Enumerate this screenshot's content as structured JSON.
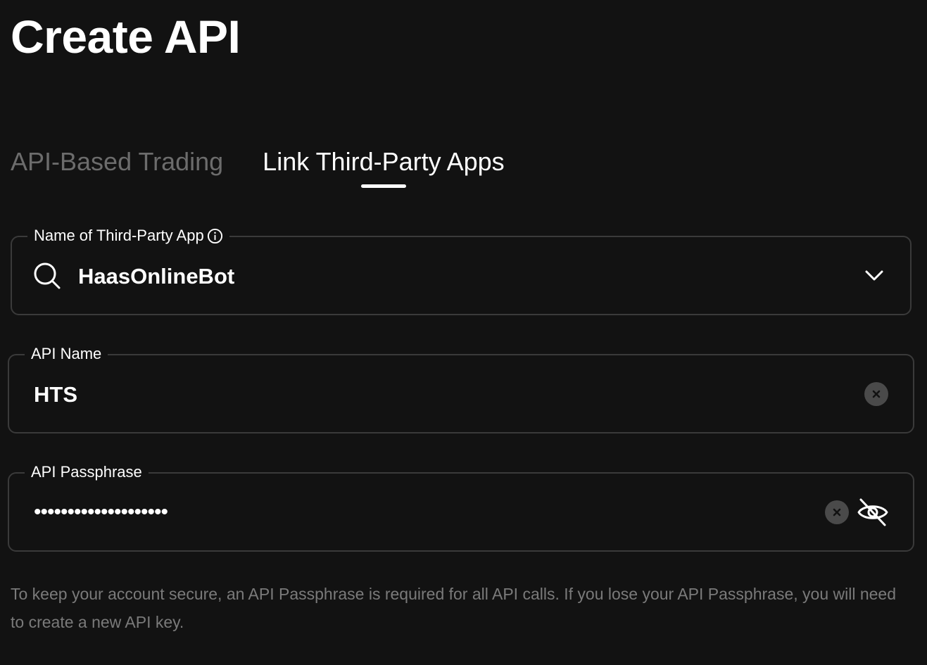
{
  "page": {
    "title": "Create API"
  },
  "tabs": [
    {
      "label": "API-Based Trading",
      "active": false
    },
    {
      "label": "Link Third-Party Apps",
      "active": true
    }
  ],
  "third_party_app": {
    "label": "Name of Third-Party App",
    "value": "HaasOnlineBot",
    "icons": [
      "info-icon",
      "search-icon",
      "chevron-down-icon"
    ]
  },
  "api_name": {
    "label": "API Name",
    "value": "HTS",
    "icons": [
      "clear-icon"
    ]
  },
  "api_passphrase": {
    "label": "API Passphrase",
    "masked_value": "••••••••••••••••••••",
    "icons": [
      "clear-icon",
      "eye-off-icon"
    ]
  },
  "helper_text": "To keep your account secure, an API Passphrase is required for all API calls. If you lose your API Passphrase, you will need to create a new API key.",
  "colors": {
    "background": "#121212",
    "border": "#3a3a3a",
    "text_primary": "#ffffff",
    "text_muted": "#7a7a7a",
    "tab_inactive": "#6c6c6c",
    "clear_button": "#4a4a4a"
  }
}
